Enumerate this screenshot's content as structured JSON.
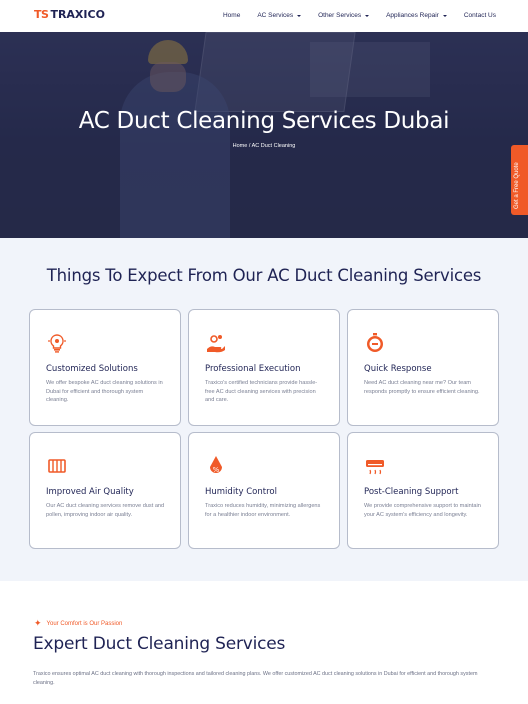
{
  "header": {
    "logo_mark": "TS",
    "logo_text": "TRAXICO",
    "nav": [
      {
        "label": "Home",
        "dropdown": false
      },
      {
        "label": "AC Services",
        "dropdown": true
      },
      {
        "label": "Other Services",
        "dropdown": true
      },
      {
        "label": "Appliances Repair",
        "dropdown": true
      },
      {
        "label": "Contact Us",
        "dropdown": false
      }
    ]
  },
  "hero": {
    "title": "AC Duct Cleaning Services Dubai",
    "breadcrumb": "Home / AC Duct Cleaning",
    "quote_tab": "Get a Free Quote"
  },
  "features": {
    "title": "Things To Expect From Our AC Duct Cleaning Services",
    "cards": [
      {
        "icon": "lightbulb-gear-icon",
        "title": "Customized Solutions",
        "desc": "We offer bespoke AC duct cleaning solutions in Dubai for efficient and thorough system cleaning."
      },
      {
        "icon": "hand-gears-icon",
        "title": "Professional Execution",
        "desc": "Traxico's certified technicians provide hassle-free AC duct cleaning services with precision and care."
      },
      {
        "icon": "stopwatch-icon",
        "title": "Quick Response",
        "desc": "Need AC duct cleaning near me? Our team responds promptly to ensure efficient cleaning."
      },
      {
        "icon": "air-filter-icon",
        "title": "Improved Air Quality",
        "desc": "Our AC duct cleaning services remove dust and pollen, improving indoor air quality."
      },
      {
        "icon": "humidity-drop-icon",
        "title": "Humidity Control",
        "desc": "Traxico reduces humidity, minimizing allergens for a healthier indoor environment."
      },
      {
        "icon": "air-conditioner-icon",
        "title": "Post-Cleaning Support",
        "desc": "We provide comprehensive support to maintain your AC system's efficiency and longevity."
      }
    ]
  },
  "expert": {
    "tagline": "Your Comfort is Our Passion",
    "title": "Expert Duct Cleaning Services",
    "desc": "Traxico ensures optimal AC duct cleaning with thorough inspections and tailored cleaning plans. We offer customized AC duct cleaning solutions in Dubai for efficient and thorough system cleaning."
  },
  "colors": {
    "accent": "#f05a28",
    "navy": "#1f2354",
    "section_bg": "#f1f4fa"
  }
}
